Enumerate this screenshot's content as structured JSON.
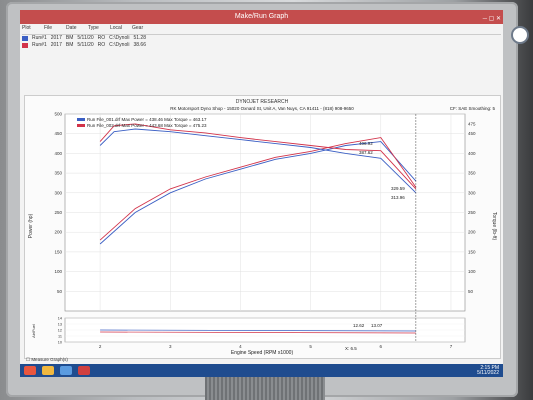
{
  "window": {
    "title": "Make/Run Graph"
  },
  "run_table": {
    "headers": [
      "Plot",
      "File",
      "Date",
      "Type",
      "Local",
      "Gear"
    ],
    "rows": [
      {
        "file": "Run#1",
        "year": "2017",
        "type": "BM",
        "date": "5/11/20",
        "local": "RO",
        "path": "C:\\Dynoli",
        "gear": "51.28"
      },
      {
        "file": "Run#1",
        "year": "2017",
        "type": "BM",
        "date": "5/11/20",
        "local": "RO",
        "path": "C:\\Dynoli",
        "gear": "38.66"
      }
    ]
  },
  "chart": {
    "brand": "DYNOJET RESEARCH",
    "header": "RK Motorsport Dyno Shop - 15020 Oxnard St, Unit A, Van Nuys, CA 91411 - (818) 908-9650",
    "correction": "CF: SAE  Smoothing: 5",
    "legend": [
      {
        "text": "Run File_001.drf Max Power = 438.46  Max Torque = 463.17",
        "color": "#3b5fc4"
      },
      {
        "text": "Run File_002.drf Max Power = 443.68  Max Torque = 475.23",
        "color": "#d2334a"
      }
    ],
    "value_labels": [
      "406.92",
      "387.62",
      "329.59",
      "313.96"
    ],
    "low_labels": [
      "12.62",
      "13.07"
    ],
    "left_axis_label": "Power (hp)",
    "right_axis_label": "Torque (lb-ft)",
    "afr_axis_label": "Air/Fuel",
    "x_axis_label": "Engine Speed (RPM x1000)",
    "x_ticks": [
      "2",
      "3",
      "4",
      "5",
      "6",
      "7"
    ],
    "y_ticks_left": [
      "500",
      "450",
      "400",
      "350",
      "300",
      "250",
      "200",
      "150",
      "100",
      "50"
    ],
    "y_ticks_right": [
      "475",
      "450",
      "400",
      "350",
      "300",
      "250",
      "200",
      "150",
      "100",
      "50"
    ],
    "afr_ticks": [
      "14",
      "13",
      "12",
      "11",
      "10"
    ],
    "x_marker": "X: 6.5"
  },
  "chart_data": [
    {
      "type": "line",
      "x_label": "Engine Speed (RPM x1000)",
      "y_label": "Power (hp)",
      "y2_label": "Torque (lb-ft)",
      "xlim": [
        1.5,
        7.2
      ],
      "ylim": [
        0,
        500
      ],
      "series": [
        {
          "name": "Run File_001.drf Power",
          "color": "#3b5fc4",
          "x": [
            2.0,
            2.5,
            3.0,
            3.5,
            4.0,
            4.5,
            5.0,
            5.5,
            6.0,
            6.5
          ],
          "y": [
            170,
            250,
            300,
            335,
            360,
            385,
            400,
            420,
            430,
            329.59
          ]
        },
        {
          "name": "Run File_002.drf Power",
          "color": "#d2334a",
          "x": [
            2.0,
            2.5,
            3.0,
            3.5,
            4.0,
            4.5,
            5.0,
            5.5,
            6.0,
            6.5
          ],
          "y": [
            180,
            260,
            310,
            340,
            365,
            390,
            405,
            425,
            440,
            313.96
          ]
        },
        {
          "name": "Run File_001.drf Torque",
          "color": "#3b5fc4",
          "x": [
            2.0,
            2.2,
            2.5,
            3.0,
            3.5,
            4.0,
            4.5,
            5.0,
            5.5,
            6.0,
            6.5
          ],
          "y": [
            420,
            455,
            462,
            455,
            445,
            435,
            425,
            415,
            400,
            387.62,
            300
          ]
        },
        {
          "name": "Run File_002.drf Torque",
          "color": "#d2334a",
          "x": [
            2.0,
            2.2,
            2.5,
            3.0,
            3.5,
            4.0,
            4.5,
            5.0,
            5.5,
            6.0,
            6.5
          ],
          "y": [
            430,
            470,
            475,
            460,
            452,
            440,
            430,
            420,
            410,
            406.92,
            310
          ]
        }
      ]
    }
  ],
  "taskbar": {
    "time": "2:15 PM",
    "date": "5/11/2022"
  },
  "footer": {
    "checkbox_label": "Measure Graph(s)"
  }
}
